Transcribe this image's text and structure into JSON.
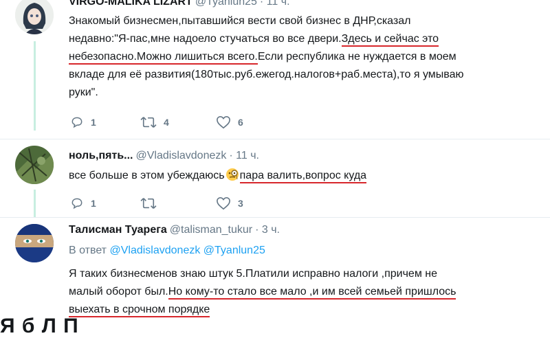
{
  "tweets": [
    {
      "name": "VIRGO-MALIKA LIZART",
      "handle": "@Tyanlun25",
      "time": "· 11 ч.",
      "lines": [
        "Знакомый бизнесмен,пытавшийся вести свой бизнес в ДНР,сказал",
        "недавно:\"Я-пас,мне надоело стучаться во все двери.",
        "Здесь и сейчас это",
        "небезопасно.Можно лишиться всего.",
        "Если республика не нуждается в моем",
        "вкладе для её развития(180тыс.руб.ежегод.налогов+раб.места),то я умываю",
        "руки\"."
      ],
      "replies": "1",
      "retweets": "4",
      "likes": "6"
    },
    {
      "name": "ноль,пять...",
      "handle": "@Vladislavdonezk",
      "time": "· 11 ч.",
      "text_before": "все больше в этом убеждаюсь",
      "emoji": "face-with-monocle-icon",
      "text_underlined": "пара валить,вопрос куда",
      "replies": "1",
      "retweets": "",
      "likes": "3"
    },
    {
      "name": "Талисман Туарега",
      "handle": "@talisman_tukur",
      "time": "· 3 ч.",
      "reply_label": "В ответ",
      "reply_mentions": "@Vladislavdonezk @Tyanlun25",
      "lines": [
        "Я таких бизнесменов знаю штук 5.Платили исправно налоги ,причем не",
        "малый оборот был.",
        "Но кому-то стало все мало ,и им всей семьей пришлось",
        "выехать в срочном порядке"
      ]
    }
  ],
  "cut_text": "Я                          б                                                     Л П",
  "colors": {
    "underline": "#d7262b",
    "meta": "#657786",
    "link": "#1da1f2",
    "thread": "#c7eee0"
  }
}
